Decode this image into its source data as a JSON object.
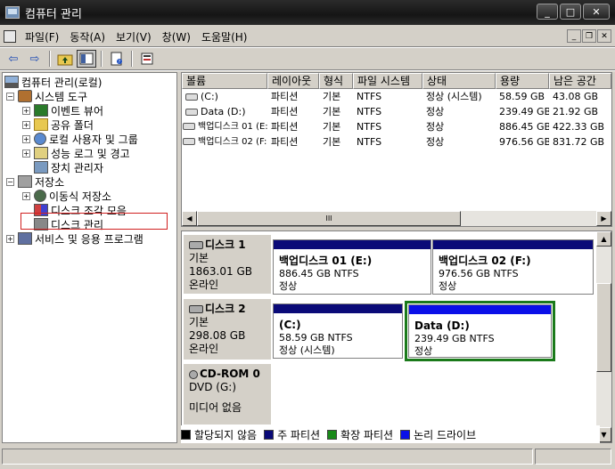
{
  "window": {
    "title": "컴퓨터 관리"
  },
  "window_controls": {
    "minimize": "_",
    "maximize": "□",
    "close": "✕"
  },
  "menu": [
    "파일(F)",
    "동작(A)",
    "보기(V)",
    "창(W)",
    "도움말(H)"
  ],
  "mdi_controls": {
    "minimize": "_",
    "restore": "❐",
    "close": "✕"
  },
  "toolbar": {
    "back": "⇦",
    "forward": "⇨"
  },
  "tree": {
    "root": "컴퓨터 관리(로컬)",
    "system_tools": "시스템 도구",
    "event_viewer": "이벤트 뷰어",
    "shared_folders": "공유 폴더",
    "local_users": "로컬 사용자 및 그룹",
    "perf_logs": "성능 로그 및 경고",
    "device_manager": "장치 관리자",
    "storage": "저장소",
    "removable": "이동식 저장소",
    "defrag": "디스크 조각 모음",
    "disk_mgmt": "디스크 관리",
    "services": "서비스 및 응용 프로그램",
    "expand_plus": "+",
    "expand_minus": "−"
  },
  "volume_list": {
    "columns": [
      "볼륨",
      "레이아웃",
      "형식",
      "파일 시스템",
      "상태",
      "용량",
      "남은 공간"
    ],
    "rows": [
      [
        "(C:)",
        "파티션",
        "기본",
        "NTFS",
        "정상 (시스템)",
        "58.59 GB",
        "43.08 GB"
      ],
      [
        "Data (D:)",
        "파티션",
        "기본",
        "NTFS",
        "정상",
        "239.49 GB",
        "21.92 GB"
      ],
      [
        "백업디스크 01 (E:)",
        "파티션",
        "기본",
        "NTFS",
        "정상",
        "886.45 GB",
        "422.33 GB"
      ],
      [
        "백업디스크 02 (F:)",
        "파티션",
        "기본",
        "NTFS",
        "정상",
        "976.56 GB",
        "831.72 GB"
      ]
    ],
    "hscroll": {
      "left": "◀",
      "right": "▶",
      "grip": "III"
    }
  },
  "disks": [
    {
      "name": "디스크 1",
      "type": "기본",
      "size": "1863.01 GB",
      "status": "온라인"
    },
    {
      "name": "디스크 2",
      "type": "기본",
      "size": "298.08 GB",
      "status": "온라인"
    },
    {
      "name": "CD-ROM 0",
      "type": "DVD (G:)",
      "size": "",
      "status": "미디어 없음"
    }
  ],
  "partitions": {
    "p1": {
      "name": "백업디스크 01  (E:)",
      "size": "886.45 GB NTFS",
      "status": "정상"
    },
    "p2": {
      "name": "백업디스크 02  (F:)",
      "size": "976.56 GB NTFS",
      "status": "정상"
    },
    "p3": {
      "name": "(C:)",
      "size": "58.59 GB NTFS",
      "status": "정상 (시스템)"
    },
    "p4": {
      "name": "Data  (D:)",
      "size": "239.49 GB NTFS",
      "status": "정상"
    }
  },
  "vscroll": {
    "up": "▲",
    "down": "▼"
  },
  "legend": [
    {
      "label": "할당되지 않음",
      "color": "#000000"
    },
    {
      "label": "주 파티션",
      "color": "#0a0a78"
    },
    {
      "label": "확장 파티션",
      "color": "#1a8a1a"
    },
    {
      "label": "논리 드라이브",
      "color": "#0a10e8"
    }
  ]
}
